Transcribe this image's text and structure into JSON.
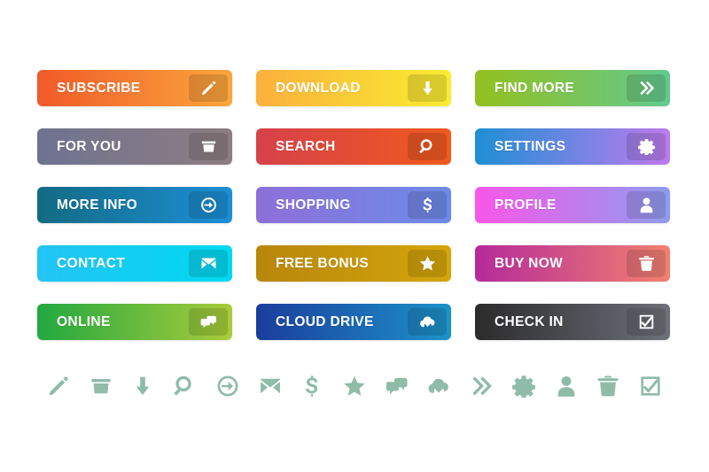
{
  "page": {
    "title": "Gradient Call-To-Action Button Set",
    "background": "#ffffff"
  },
  "buttons": [
    {
      "id": "subscribe",
      "label": "SUBSCRIBE",
      "icon": "pencil-icon",
      "grad_from": "#F15A29",
      "grad_to": "#FBA63C",
      "col": 1,
      "row": 1
    },
    {
      "id": "download",
      "label": "DOWNLOAD",
      "icon": "download-arrow-icon",
      "grad_from": "#FBB03B",
      "grad_to": "#F9ED32",
      "col": 2,
      "row": 1
    },
    {
      "id": "find-more",
      "label": "FIND MORE",
      "icon": "double-chevron-icon",
      "grad_from": "#93C01F",
      "grad_to": "#62C98F",
      "col": 3,
      "row": 1
    },
    {
      "id": "for-you",
      "label": "FOR YOU",
      "icon": "basket-icon",
      "grad_from": "#6E7391",
      "grad_to": "#8E7D80",
      "col": 1,
      "row": 2
    },
    {
      "id": "search",
      "label": "SEARCH",
      "icon": "magnifier-icon",
      "grad_from": "#D6414A",
      "grad_to": "#F05A1E",
      "col": 2,
      "row": 2
    },
    {
      "id": "settings",
      "label": "SETTINGS",
      "icon": "gear-icon",
      "grad_from": "#1E8FD5",
      "grad_to": "#BE7BEE",
      "col": 3,
      "row": 2
    },
    {
      "id": "more-info",
      "label": "MORE INFO",
      "icon": "arrow-circle-icon",
      "grad_from": "#136B84",
      "grad_to": "#1C8FD6",
      "col": 1,
      "row": 3
    },
    {
      "id": "shopping",
      "label": "SHOPPING",
      "icon": "dollar-icon",
      "grad_from": "#8E6FD8",
      "grad_to": "#6C8BE8",
      "col": 2,
      "row": 3
    },
    {
      "id": "profile",
      "label": "PROFILE",
      "icon": "user-icon",
      "grad_from": "#F956E8",
      "grad_to": "#8F9CF0",
      "col": 3,
      "row": 3
    },
    {
      "id": "contact",
      "label": "CONTACT",
      "icon": "envelope-icon",
      "grad_from": "#23C4F5",
      "grad_to": "#00D9F0",
      "col": 1,
      "row": 4
    },
    {
      "id": "free-bonus",
      "label": "FREE BONUS",
      "icon": "star-icon",
      "grad_from": "#B8860B",
      "grad_to": "#D4A60A",
      "col": 2,
      "row": 4
    },
    {
      "id": "buy-now",
      "label": "BUY NOW",
      "icon": "trash-icon",
      "grad_from": "#B52A9B",
      "grad_to": "#F2816F",
      "col": 3,
      "row": 4
    },
    {
      "id": "online",
      "label": "ONLINE",
      "icon": "chat-icon",
      "grad_from": "#22A840",
      "grad_to": "#A9CC3A",
      "col": 1,
      "row": 5
    },
    {
      "id": "cloud-drive",
      "label": "CLOUD DRIVE",
      "icon": "cloud-download-icon",
      "grad_from": "#1B3D9C",
      "grad_to": "#1C93C9",
      "col": 2,
      "row": 5
    },
    {
      "id": "check-in",
      "label": "CHECK IN",
      "icon": "checkbox-icon",
      "grad_from": "#2B2B2B",
      "grad_to": "#6E717A",
      "col": 3,
      "row": 5
    }
  ],
  "icon_strip": {
    "color": "#8FBCA8",
    "icons": [
      "pencil-icon",
      "basket-icon",
      "download-arrow-icon",
      "magnifier-icon",
      "arrow-circle-icon",
      "envelope-icon",
      "dollar-icon",
      "star-icon",
      "chat-icon",
      "cloud-download-icon",
      "double-chevron-icon",
      "gear-icon",
      "user-icon",
      "trash-icon",
      "checkbox-icon"
    ]
  }
}
